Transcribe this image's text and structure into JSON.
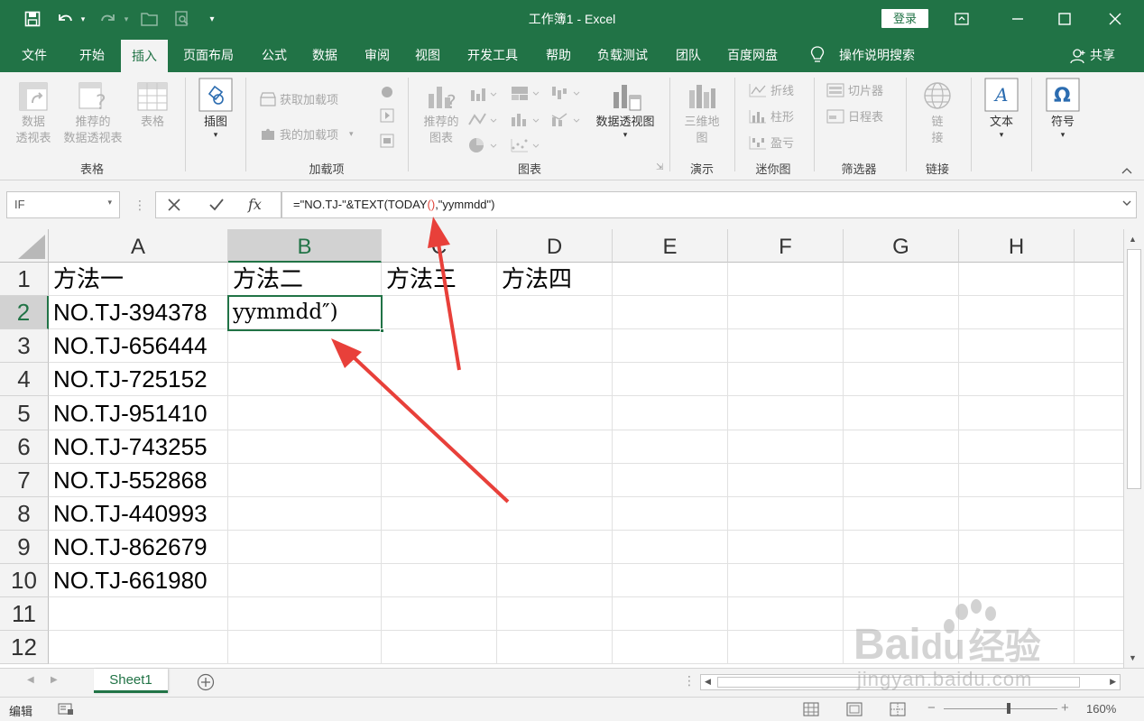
{
  "title_bar": {
    "doc_title": "工作簿1  -  Excel",
    "login_label": "登录"
  },
  "menu": {
    "tabs": [
      "文件",
      "开始",
      "插入",
      "页面布局",
      "公式",
      "数据",
      "审阅",
      "视图",
      "开发工具",
      "帮助",
      "负载测试",
      "团队",
      "百度网盘"
    ],
    "active_tab": "插入",
    "tell_me": "操作说明搜索",
    "share": "共享"
  },
  "ribbon": {
    "tables": {
      "pivot": "数据\n透视表",
      "recommended_pivot": "推荐的\n数据透视表",
      "table": "表格",
      "group": "表格"
    },
    "illustrations": {
      "label": "插图"
    },
    "addins": {
      "get": "获取加载项",
      "my": "我的加载项",
      "group": "加载项"
    },
    "charts": {
      "recommended": "推荐的\n图表",
      "pivot_chart": "数据透视图",
      "group": "图表"
    },
    "tours": {
      "map3d": "三维地\n图",
      "group": "演示"
    },
    "sparklines": {
      "line": "折线",
      "column": "柱形",
      "winloss": "盈亏",
      "group": "迷你图"
    },
    "filters": {
      "slicer": "切片器",
      "timeline": "日程表",
      "group": "筛选器"
    },
    "links": {
      "link": "链\n接",
      "group": "链接"
    },
    "text": {
      "label": "文本"
    },
    "symbols": {
      "label": "符号"
    }
  },
  "formula_bar": {
    "name_box": "IF",
    "formula_prefix": "=\"NO.TJ-\"&TEXT(TODAY",
    "formula_paren": "()",
    "formula_suffix": ",\"yymmdd\")"
  },
  "grid": {
    "columns": [
      "A",
      "B",
      "C",
      "D",
      "E",
      "F",
      "G",
      "H"
    ],
    "rows": [
      "1",
      "2",
      "3",
      "4",
      "5",
      "6",
      "7",
      "8",
      "9",
      "10",
      "11",
      "12"
    ],
    "selected_column": "B",
    "selected_row": "2",
    "cells": {
      "A1": "方法一",
      "B1": "方法二",
      "C1": "方法三",
      "D1": "方法四",
      "A2": "NO.TJ-394378",
      "B2": "yymmdd″)",
      "A3": "NO.TJ-656444",
      "A4": "NO.TJ-725152",
      "A5": "NO.TJ-951410",
      "A6": "NO.TJ-743255",
      "A7": "NO.TJ-552868",
      "A8": "NO.TJ-440993",
      "A9": "NO.TJ-862679",
      "A10": "NO.TJ-661980"
    }
  },
  "sheets": {
    "active": "Sheet1"
  },
  "status": {
    "mode": "编辑",
    "zoom": "160%"
  },
  "watermark": {
    "brand": "Bai",
    "brand2": "du",
    "cn": "经验",
    "url": "jingyan.baidu.com"
  },
  "colors": {
    "accent": "#217346",
    "arrow": "#e8403a"
  }
}
